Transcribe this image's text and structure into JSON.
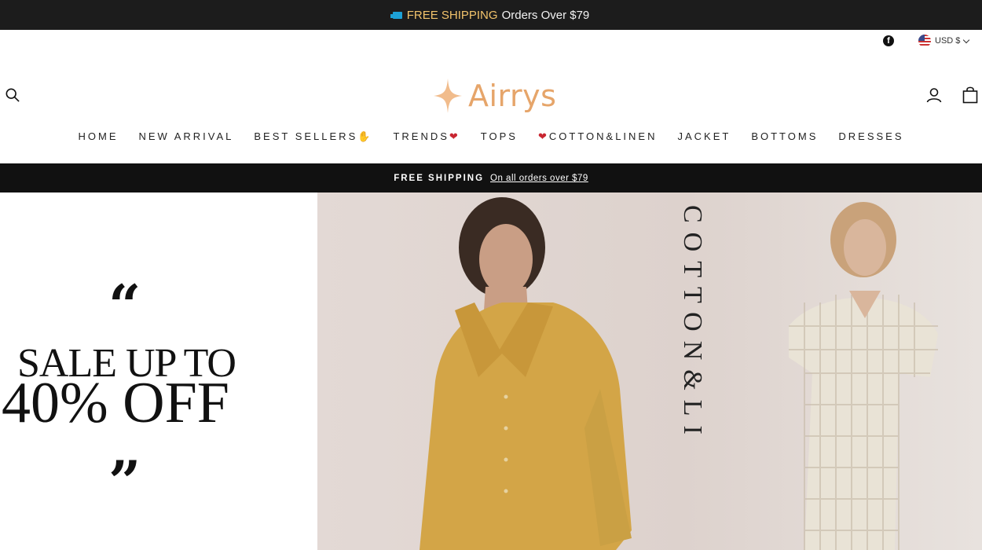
{
  "announcement": {
    "icon": "truck-icon",
    "strong_text": "FREE SHIPPING",
    "text": "Orders Over $79"
  },
  "utility": {
    "facebook_icon": "f",
    "currency": "USD $"
  },
  "logo": {
    "name": "Airrys"
  },
  "nav": [
    {
      "label": "HOME"
    },
    {
      "label": "NEW ARRIVAL"
    },
    {
      "label": "BEST SELLERS",
      "suffix": "✋"
    },
    {
      "label": "TRENDS",
      "suffix": "❤"
    },
    {
      "label": "TOPS"
    },
    {
      "label": "COTTON&LINEN",
      "prefix": "❤"
    },
    {
      "label": "JACKET"
    },
    {
      "label": "BOTTOMS"
    },
    {
      "label": "DRESSES"
    }
  ],
  "promo": {
    "label": "FREE SHIPPING",
    "link": "On all orders over $79"
  },
  "hero": {
    "quote_open": "“",
    "quote_close": "”",
    "sale_line1": "SALE UP TO",
    "sale_line2": "40% OFF",
    "vertical_title": "COTTON&LI"
  },
  "colors": {
    "accent": "#e6a56a",
    "top_bar": "#1c1c1c",
    "promo_bar": "#111111",
    "hero_bg": "#e1d8d4"
  }
}
